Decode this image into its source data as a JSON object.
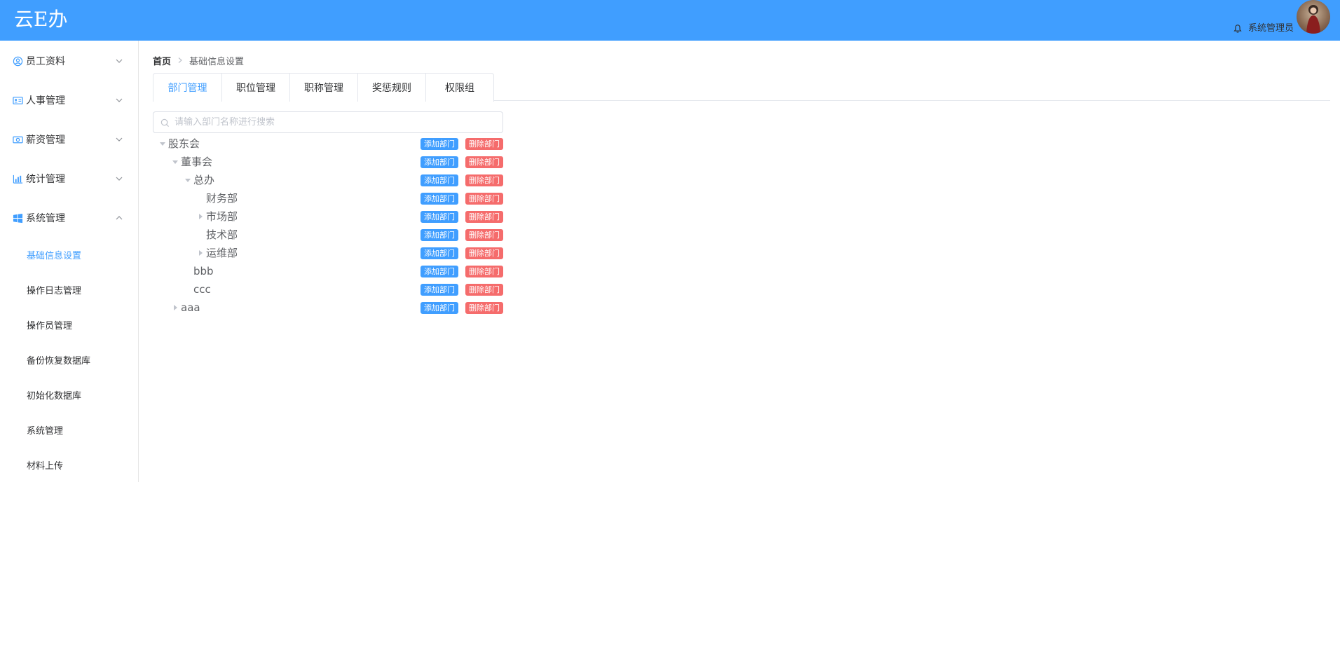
{
  "header": {
    "logo": "云E办",
    "username": "系统管理员"
  },
  "sidebar": {
    "menus": [
      {
        "label": "员工资料",
        "icon": "user-circle-icon",
        "arrow": "down"
      },
      {
        "label": "人事管理",
        "icon": "id-card-icon",
        "arrow": "down"
      },
      {
        "label": "薪资管理",
        "icon": "money-icon",
        "arrow": "down"
      },
      {
        "label": "统计管理",
        "icon": "bar-chart-icon",
        "arrow": "down"
      },
      {
        "label": "系统管理",
        "icon": "windows-icon",
        "arrow": "up"
      }
    ],
    "submenu": [
      {
        "label": "基础信息设置",
        "active": true
      },
      {
        "label": "操作日志管理"
      },
      {
        "label": "操作员管理"
      },
      {
        "label": "备份恢复数据库"
      },
      {
        "label": "初始化数据库"
      },
      {
        "label": "系统管理"
      },
      {
        "label": "材料上传"
      }
    ]
  },
  "breadcrumb": {
    "home": "首页",
    "current": "基础信息设置"
  },
  "tabs": [
    {
      "label": "部门管理",
      "active": true
    },
    {
      "label": "职位管理"
    },
    {
      "label": "职称管理"
    },
    {
      "label": "奖惩规则"
    },
    {
      "label": "权限组"
    }
  ],
  "search": {
    "placeholder": "请输入部门名称进行搜索",
    "value": ""
  },
  "tree": {
    "add_label": "添加部门",
    "delete_label": "删除部门",
    "nodes": [
      {
        "label": "股东会",
        "level": 0,
        "expander": "expanded"
      },
      {
        "label": "董事会",
        "level": 1,
        "expander": "expanded"
      },
      {
        "label": "总办",
        "level": 2,
        "expander": "expanded"
      },
      {
        "label": "财务部",
        "level": 3,
        "expander": "none"
      },
      {
        "label": "市场部",
        "level": 3,
        "expander": "collapsed"
      },
      {
        "label": "技术部",
        "level": 3,
        "expander": "none"
      },
      {
        "label": "运维部",
        "level": 3,
        "expander": "collapsed"
      },
      {
        "label": "bbb",
        "level": 2,
        "expander": "none"
      },
      {
        "label": "ccc",
        "level": 2,
        "expander": "none"
      },
      {
        "label": "aaa",
        "level": 1,
        "expander": "collapsed"
      }
    ]
  },
  "colors": {
    "primary": "#409eff",
    "danger": "#f56c6c",
    "text": "#303133"
  }
}
